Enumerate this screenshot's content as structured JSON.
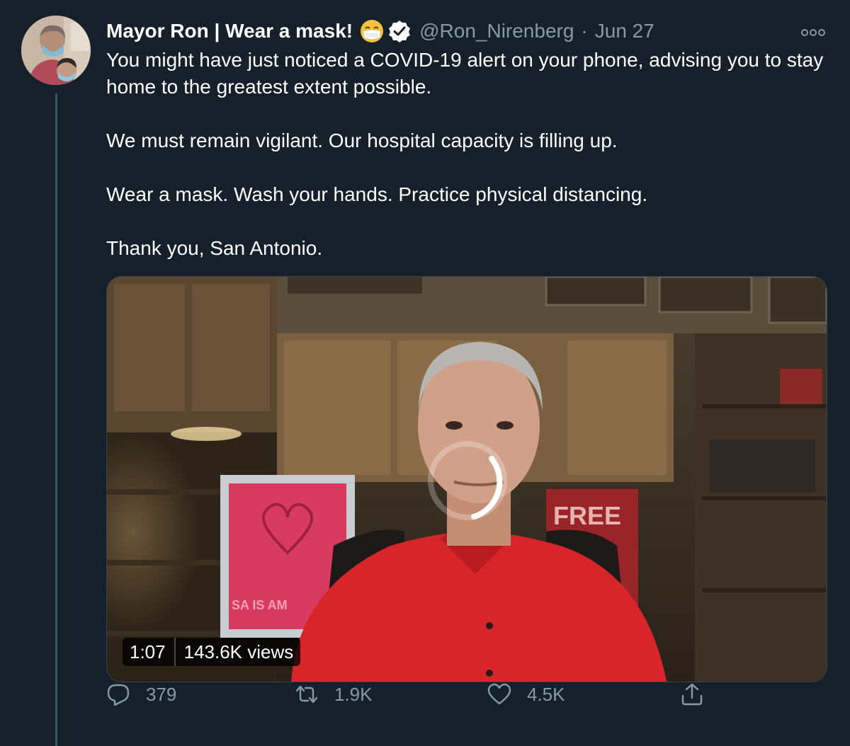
{
  "tweet": {
    "display_name": "Mayor Ron | Wear a mask!",
    "handle": "@Ron_Nirenberg",
    "separator": "·",
    "date": "Jun 27",
    "paragraphs": [
      "You might have just noticed a COVID-19 alert on your phone, advising you to stay home to the greatest extent possible.",
      "We must remain vigilant. Our hospital capacity is filling up.",
      "Wear a mask. Wash your hands. Practice physical distancing.",
      "Thank you, San Antonio."
    ]
  },
  "video": {
    "duration": "1:07",
    "views": "143.6K views",
    "poster_text_left": "SA IS AM",
    "poster_text_right": "FREE"
  },
  "actions": {
    "reply_count": "379",
    "retweet_count": "1.9K",
    "like_count": "4.5K"
  },
  "icons": {
    "reply": "reply-icon",
    "retweet": "retweet-icon",
    "like": "heart-icon",
    "share": "share-icon",
    "more": "more-icon",
    "verified": "verified-badge-icon",
    "emoji": "face-with-mask-emoji"
  },
  "colors": {
    "background": "#15202b",
    "secondary_text": "#8899a6",
    "border": "#38444d",
    "shirt_red": "#d8252a"
  }
}
